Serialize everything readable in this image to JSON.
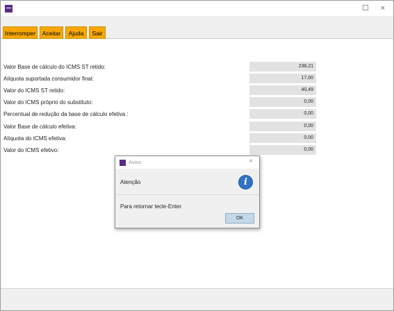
{
  "window": {
    "close": "×",
    "maximize": "☐"
  },
  "toolbar": {
    "buttons": [
      "Interromper",
      "Aceitar",
      "Ajuda",
      "Sair"
    ]
  },
  "form": {
    "rows": [
      {
        "label": "Valor Base de cálculo do ICMS ST retido:",
        "value": "238,21"
      },
      {
        "label": "Alíquota suportada consumidor final:",
        "value": "17,00"
      },
      {
        "label": "Valor do ICMS ST retido:",
        "value": "40,49"
      },
      {
        "label": "Valor do ICMS próprio do substituto:",
        "value": "0,00"
      },
      {
        "label": "Percentual de redução da base de cálculo efetiva :",
        "value": "0,00"
      },
      {
        "label": "Valor Base de cálculo efetiva:",
        "value": "0,00"
      },
      {
        "label": "Alíquota do ICMS efetiva:",
        "value": "0,00"
      },
      {
        "label": "Valor do ICMS efetivo:",
        "value": "0,00"
      }
    ]
  },
  "dialog": {
    "title": "Aviso",
    "close": "×",
    "heading": "Atenção",
    "icon": "info-icon",
    "icon_glyph": "i",
    "message": "Para retornar tecle-Enter",
    "ok_label": "OK"
  },
  "colors": {
    "toolbar_button": "#f7a800",
    "app_icon": "#5b2b86",
    "info_icon": "#2f74c6",
    "value_field": "#e2e2e2"
  }
}
